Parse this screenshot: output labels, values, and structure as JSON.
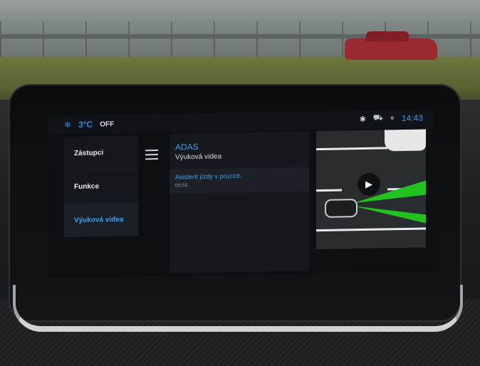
{
  "status_bar": {
    "ac_status": "OFF",
    "clock": "14:43",
    "icons": [
      "snowflake-icon",
      "recirculation-icon",
      "bluetooth-icon",
      "car-icon",
      "location-icon"
    ]
  },
  "menu": {
    "items": [
      {
        "label": "Zástupci",
        "active": false
      },
      {
        "label": "Funkce",
        "active": false
      },
      {
        "label": "Výuková videa",
        "active": true
      }
    ]
  },
  "content": {
    "title": "ADAS",
    "subtitle": "Výuková videa",
    "videos": [
      {
        "title": "Asistent jízdy v pruzích",
        "duration": "00:56"
      }
    ]
  },
  "colors": {
    "accent": "#3aa0f0",
    "beam": "#22c21e"
  }
}
